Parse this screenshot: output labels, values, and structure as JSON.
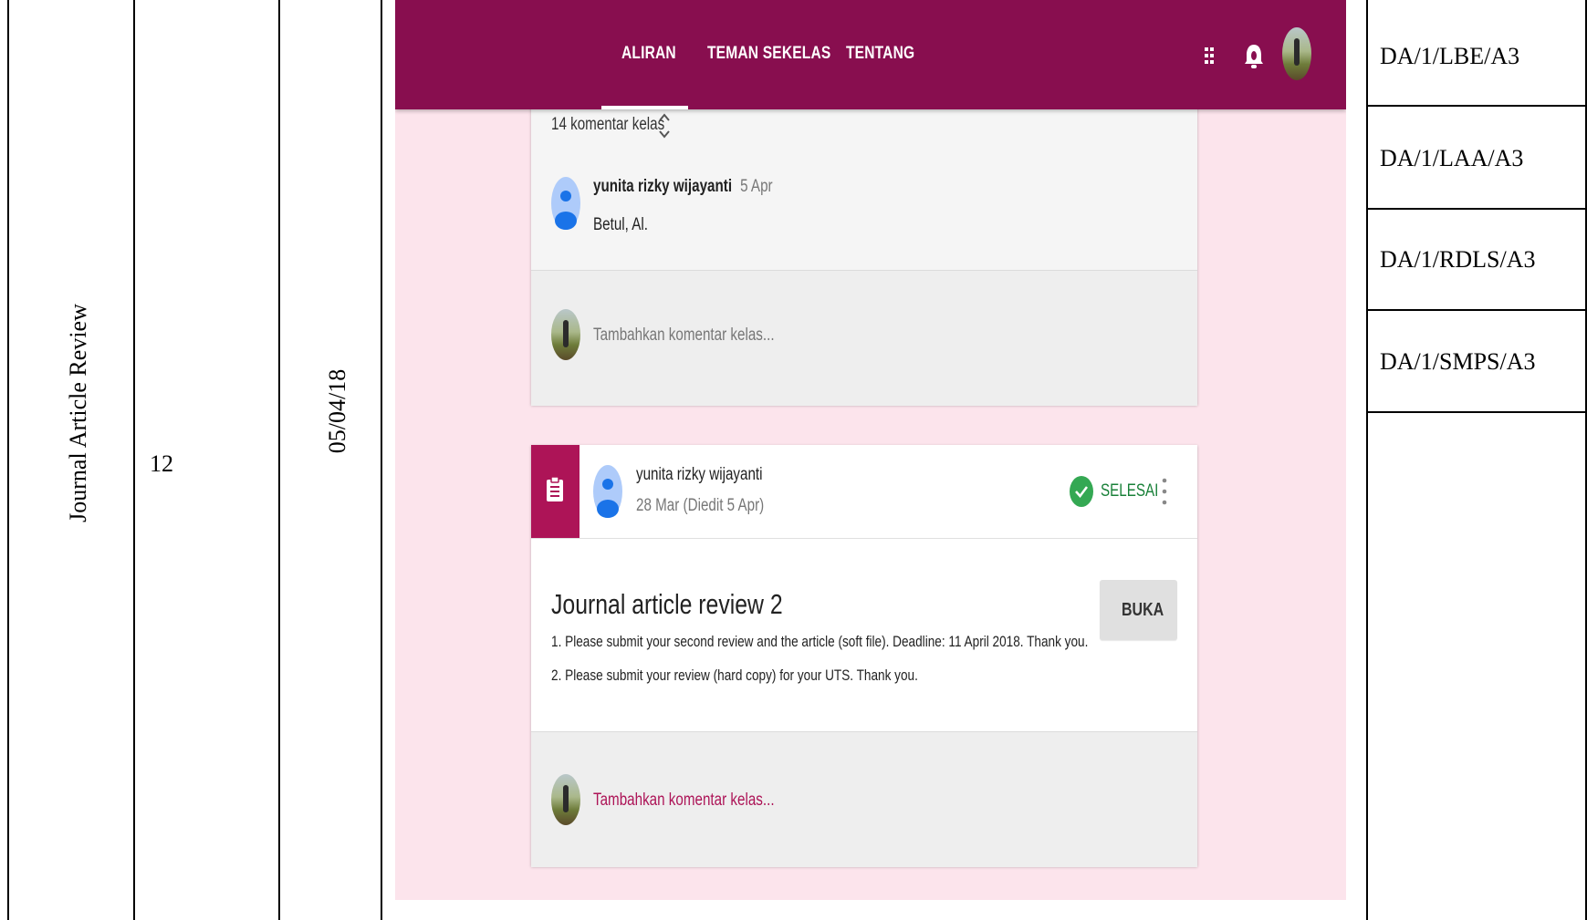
{
  "table": {
    "activity": "Journal Article Review",
    "number": "12",
    "date": "05/04/18",
    "codes": [
      "DA/1/LBE/A3",
      "DA/1/LAA/A3",
      "DA/1/RDLS/A3",
      "DA/1/SMPS/A3"
    ]
  },
  "classroom": {
    "tabs": [
      "ALIRAN",
      "TEMAN SEKELAS",
      "TENTANG"
    ],
    "active_tab": "ALIRAN",
    "colors": {
      "primary": "#880e4f",
      "background": "#fce4ec",
      "accent": "#ad1457",
      "success": "#34a853"
    },
    "comment_card": {
      "comment_count": "14 komentar kelas",
      "comment": {
        "author": "yunita rizky wijayanti",
        "date": "5 Apr",
        "text": "Betul, Al."
      },
      "add_comment_placeholder": "Tambahkan komentar kelas..."
    },
    "assignment_card": {
      "icon": "assignment-icon",
      "author": "yunita rizky wijayanti",
      "date": "28 Mar (Diedit 5 Apr)",
      "status": "SELESAI",
      "title": "Journal article review 2",
      "lines": [
        "1. Please submit your second review and the article (soft file). Deadline: 11 April 2018. Thank you.",
        "2. Please submit your review (hard copy) for your UTS. Thank you."
      ],
      "open_button": "BUKA",
      "add_comment_placeholder": "Tambahkan komentar kelas..."
    }
  }
}
